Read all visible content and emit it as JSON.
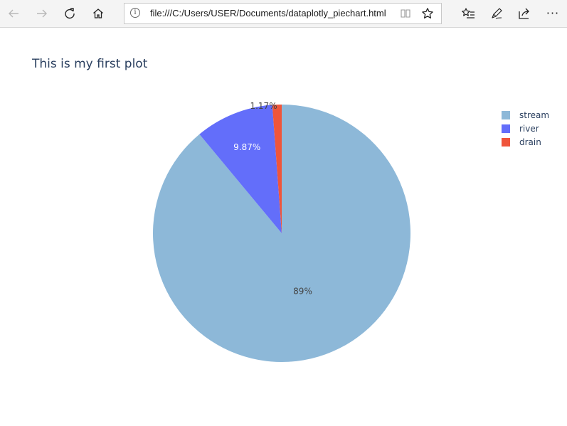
{
  "browser": {
    "url": "file:///C:/Users/USER/Documents/dataplotly_piechart.html",
    "icons": {
      "back": "back-arrow-icon",
      "forward": "forward-arrow-icon",
      "refresh": "refresh-icon",
      "home": "home-icon",
      "info": "info-icon",
      "reading_view": "reading-view-icon",
      "favorite": "star-icon",
      "favorites_hub": "favorites-list-icon",
      "notes": "pen-icon",
      "share": "share-icon",
      "more": "more-icon"
    },
    "info_glyph": "i",
    "more_glyph": "···"
  },
  "plot": {
    "title": "This is my first plot"
  },
  "chart_data": {
    "type": "pie",
    "title": "This is my first plot",
    "labels": [
      "stream",
      "river",
      "drain"
    ],
    "values": [
      89,
      9.87,
      1.17
    ],
    "text_labels": [
      "89%",
      "9.87%",
      "1.17%"
    ],
    "colors": [
      "#8db8d8",
      "#636efa",
      "#ef553b"
    ],
    "label_colors": [
      "#444444",
      "#ffffff",
      "#444444"
    ],
    "direction": "clockwise",
    "legend_placement": "top-right",
    "legend": [
      "stream",
      "river",
      "drain"
    ]
  }
}
